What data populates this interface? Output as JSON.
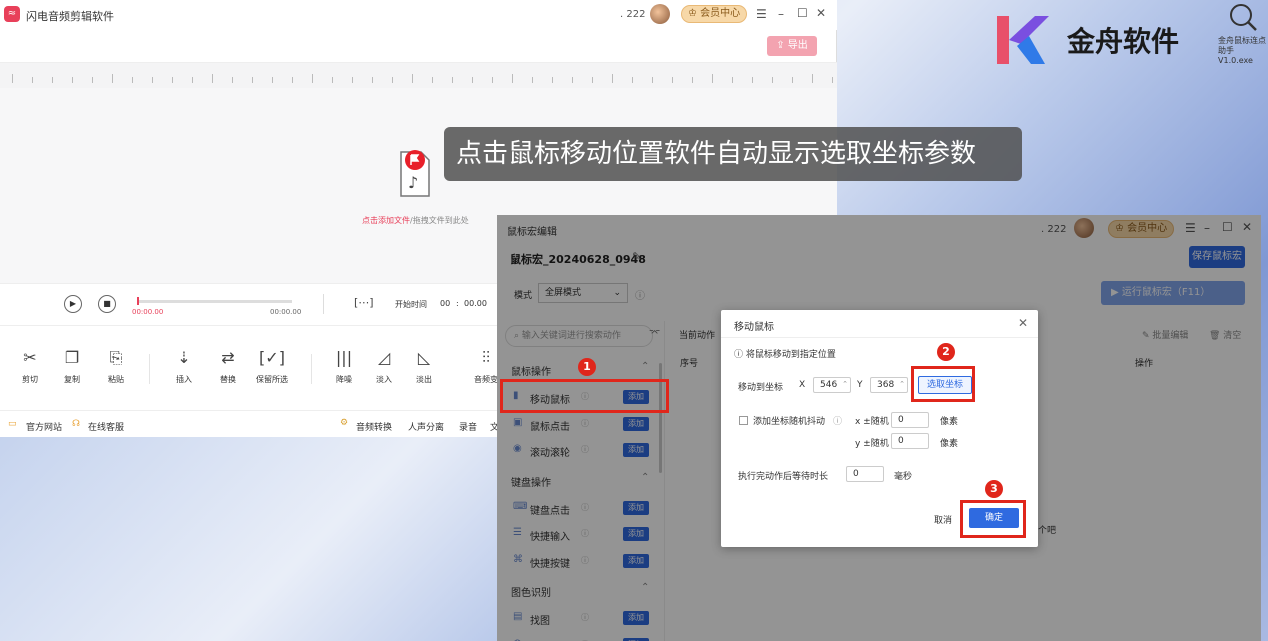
{
  "main_window": {
    "title": "闪电音频剪辑软件",
    "user_id": ". 222",
    "vip_label": "会员中心",
    "export_label": "导出",
    "add_hint_link": "点击添加文件",
    "add_hint_rest": "/拖拽文件到此处",
    "player": {
      "time_start": "00:00.00",
      "time_end": "00:00.00",
      "start_label": "开始时间",
      "start_mm": "00",
      "start_ss": "00.00"
    },
    "tools": [
      {
        "label": "剪切",
        "icon": "scissors-icon"
      },
      {
        "label": "复制",
        "icon": "copy-icon"
      },
      {
        "label": "粘贴",
        "icon": "paste-icon"
      },
      {
        "label": "插入",
        "icon": "insert-icon"
      },
      {
        "label": "替换",
        "icon": "replace-icon"
      },
      {
        "label": "保留所选",
        "icon": "keep-selection-icon"
      },
      {
        "label": "降噪",
        "icon": "denoise-icon"
      },
      {
        "label": "淡入",
        "icon": "fade-in-icon"
      },
      {
        "label": "淡出",
        "icon": "fade-out-icon"
      },
      {
        "label": "音频变",
        "icon": "equalizer-icon"
      }
    ],
    "bottom_links": {
      "website": "官方网站",
      "support": "在线客服",
      "convert": "音频转换",
      "separate": "人声分离",
      "record": "录音",
      "more": "文"
    }
  },
  "caption": "点击鼠标移动位置软件自动显示选取坐标参数",
  "brand": {
    "name": "金舟软件",
    "file_label_1": "金舟鼠标连点",
    "file_label_2": "助手V1.0.exe"
  },
  "macro_window": {
    "title": "鼠标宏编辑",
    "user_id": ". 222",
    "vip_label": "会员中心",
    "macro_name": "鼠标宏_20240628_0948",
    "save_label": "保存鼠标宏",
    "mode_label": "模式",
    "mode_value": "全屏模式",
    "run_label": "运行鼠标宏（F11）",
    "search_placeholder": "输入关键词进行搜索动作",
    "current_actions": "当前动作",
    "batch_edit": "批量编辑",
    "clear": "清空",
    "col_index": "序号",
    "col_ops": "操作",
    "partial_text": "个吧",
    "sections": [
      {
        "title": "鼠标操作",
        "items": [
          "移动鼠标",
          "鼠标点击",
          "滚动滚轮"
        ]
      },
      {
        "title": "键盘操作",
        "items": [
          "键盘点击",
          "快捷输入",
          "快捷按键"
        ]
      },
      {
        "title": "图色识别",
        "items": [
          "找图",
          "找色"
        ]
      }
    ],
    "add_label": "添加"
  },
  "dialog": {
    "title": "移动鼠标",
    "info": "将鼠标移动到指定位置",
    "coord_label": "移动到坐标",
    "x_label": "X",
    "x_value": "546",
    "y_label": "Y",
    "y_value": "368",
    "pick_label": "选取坐标",
    "jitter_label": "添加坐标随机抖动",
    "x_rand_label": "x ±随机",
    "x_rand_value": "0",
    "y_rand_label": "y ±随机",
    "y_rand_value": "0",
    "pixel_unit": "像素",
    "wait_label": "执行完动作后等待时长",
    "wait_value": "0",
    "ms_unit": "毫秒",
    "cancel_label": "取消",
    "confirm_label": "确定"
  },
  "badges": [
    "1",
    "2",
    "3"
  ],
  "colors": {
    "accent": "#2f6ae0",
    "brand_red": "#e8405a",
    "highlight_red": "#e0261b"
  }
}
